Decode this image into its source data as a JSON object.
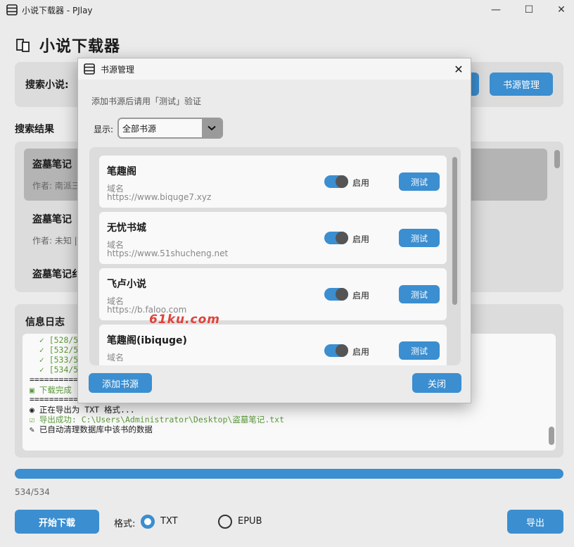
{
  "window": {
    "title": "小说下载器 - PJlay",
    "minimize": "—",
    "maximize": "☐",
    "close": "✕"
  },
  "header": {
    "title": "小说下载器"
  },
  "search": {
    "label": "搜索小说:",
    "source_manage_button": "书源管理"
  },
  "results": {
    "label": "搜索结果",
    "items": [
      {
        "title": "盗墓笔记",
        "sub": "作者: 南派三"
      },
      {
        "title": "盗墓笔记",
        "sub": "作者: 未知 |"
      },
      {
        "title": "盗墓笔记纟",
        "sub": ""
      }
    ]
  },
  "log": {
    "label": "信息日志",
    "lines": [
      "  ✓ [528/5",
      "  ✓ [532/5",
      "  ✓ [533/5",
      "  ✓ [534/5",
      "==========",
      "▣ 下载完成",
      "==========",
      "◉ 正在导出为 TXT 格式...",
      "☑ 导出成功: C:\\Users\\Administrator\\Desktop\\盗墓笔记.txt",
      "✎ 已自动清理数据库中该书的数据"
    ]
  },
  "progress": {
    "text": "534/534",
    "fraction": 1.0
  },
  "bottom": {
    "start_button": "开始下载",
    "format_label": "格式:",
    "format_txt": "TXT",
    "format_epub": "EPUB",
    "selected_format": "TXT",
    "export_button": "导出"
  },
  "modal": {
    "title": "书源管理",
    "hint": "添加书源后请用「测试」验证",
    "show_label": "显示:",
    "show_value": "全部书源",
    "domain_label": "域名",
    "enabled_label": "启用",
    "test_label": "测试",
    "sources": [
      {
        "name": "笔趣阁",
        "url": "https://www.biquge7.xyz",
        "enabled": true
      },
      {
        "name": "无忧书城",
        "url": "https://www.51shucheng.net",
        "enabled": true
      },
      {
        "name": "飞卢小说",
        "url": "https://b.faloo.com",
        "enabled": true
      },
      {
        "name": "笔趣阁(ibiquge)",
        "url": "",
        "enabled": true
      }
    ],
    "add_button": "添加书源",
    "close_button": "关闭"
  },
  "watermark": "61ku.com",
  "colors": {
    "accent": "#3b8ed0",
    "panel": "#dcdcdc",
    "log_green": "#5a9a3a"
  }
}
